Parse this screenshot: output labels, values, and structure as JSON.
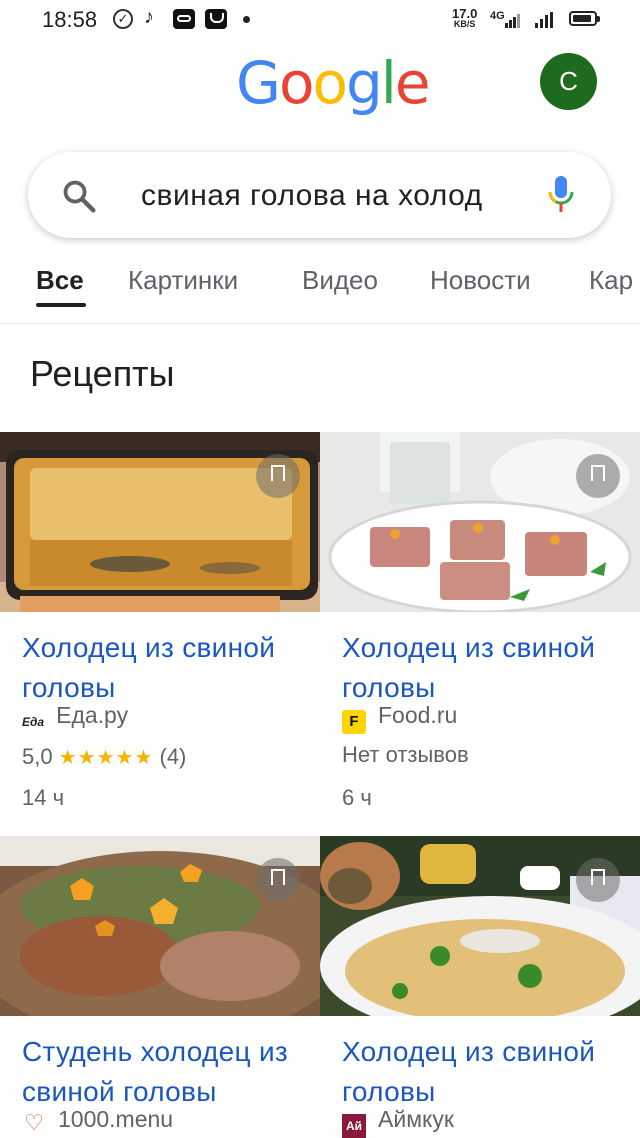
{
  "status_bar": {
    "time": "18:58",
    "speed_value": "17.0",
    "speed_unit": "KB/S",
    "network": "4G",
    "icons": [
      "check-circle-icon",
      "tiktok-icon",
      "app-icon",
      "mail-icon",
      "notification-dot-icon",
      "signal-icon",
      "battery-icon"
    ]
  },
  "header": {
    "logo_text": "Google",
    "logo_colors": {
      "blue": "#4285F4",
      "red": "#EA4335",
      "yellow": "#FBBC05",
      "green": "#34A853"
    },
    "avatar_letter": "C",
    "avatar_color": "#1e6b1e"
  },
  "search": {
    "query": "свиная голова на холод",
    "search_icon": "search-icon",
    "mic_icon": "microphone-icon"
  },
  "tabs": [
    {
      "label": "Все",
      "active": true
    },
    {
      "label": "Картинки",
      "active": false
    },
    {
      "label": "Видео",
      "active": false
    },
    {
      "label": "Новости",
      "active": false
    },
    {
      "label": "Кар",
      "active": false
    }
  ],
  "section_title": "Рецепты",
  "recipes": [
    {
      "title": "Холодец из свиной головы",
      "source": "Еда.ру",
      "source_logo": "Еда",
      "rating": "5,0",
      "stars": "★★★★★",
      "reviews": "(4)",
      "time": "14 ч"
    },
    {
      "title": "Холодец из свиной головы",
      "source": "Food.ru",
      "source_logo": "F",
      "rating_text": "Нет отзывов",
      "time": "6 ч"
    },
    {
      "title": "Студень холодец из свиной головы",
      "source": "1000.menu",
      "source_logo": "heart-icon"
    },
    {
      "title": "Холодец из свиной головы",
      "source": "Аймкук",
      "source_logo": "Ай"
    }
  ]
}
